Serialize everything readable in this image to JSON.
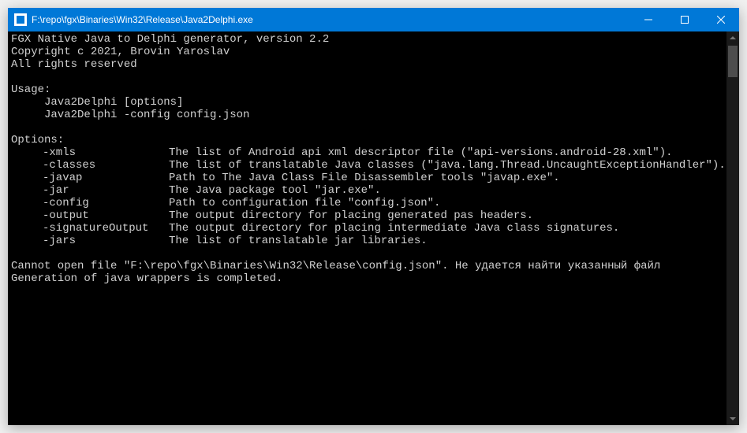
{
  "titlebar": {
    "path": "F:\\repo\\fgx\\Binaries\\Win32\\Release\\Java2Delphi.exe"
  },
  "console": {
    "header_line1": "FGX Native Java to Delphi generator, version 2.2",
    "header_line2": "Copyright c 2021, Brovin Yaroslav",
    "header_line3": "All rights reserved",
    "usage_label": "Usage:",
    "usage_line1": "     Java2Delphi [options]",
    "usage_line2": "     Java2Delphi -config config.json",
    "options_label": "Options:",
    "options": [
      {
        "name": "-xmls",
        "desc": "The list of Android api xml descriptor file (\"api-versions.android-28.xml\")."
      },
      {
        "name": "-classes",
        "desc": "The list of translatable Java classes (\"java.lang.Thread.UncaughtExceptionHandler\")."
      },
      {
        "name": "-javap",
        "desc": "Path to The Java Class File Disassembler tools \"javap.exe\"."
      },
      {
        "name": "-jar",
        "desc": "The Java package tool \"jar.exe\"."
      },
      {
        "name": "-config",
        "desc": "Path to configuration file \"config.json\"."
      },
      {
        "name": "-output",
        "desc": "The output directory for placing generated pas headers."
      },
      {
        "name": "-signatureOutput",
        "desc": "The output directory for placing intermediate Java class signatures."
      },
      {
        "name": "-jars",
        "desc": "The list of translatable jar libraries."
      }
    ],
    "error_line": "Cannot open file \"F:\\repo\\fgx\\Binaries\\Win32\\Release\\config.json\". Не удается найти указанный файл",
    "done_line": "Generation of java wrappers is completed."
  }
}
